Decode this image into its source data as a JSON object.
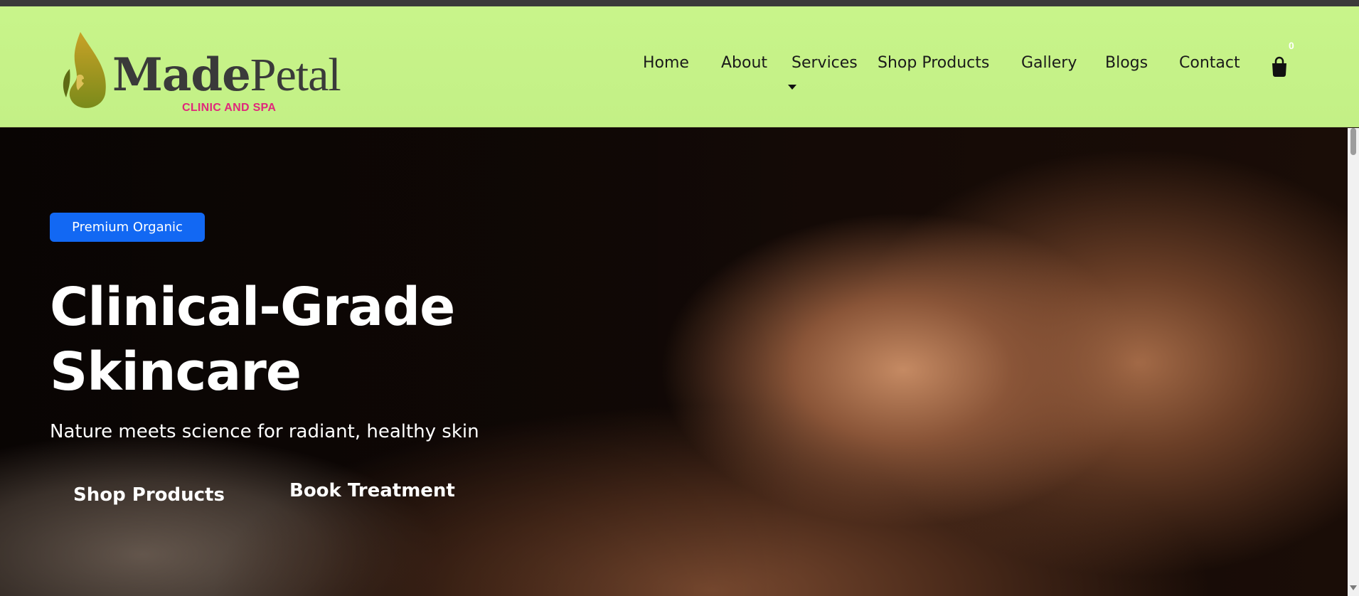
{
  "logo": {
    "name_part1": "Made",
    "name_part2": "Petal",
    "tagline": "CLINIC AND SPA"
  },
  "nav": {
    "items": [
      {
        "label": "Home"
      },
      {
        "label": "About"
      },
      {
        "label": "Services"
      },
      {
        "label": "Shop Products"
      },
      {
        "label": "Gallery"
      },
      {
        "label": "Blogs"
      },
      {
        "label": "Contact"
      }
    ],
    "cart_count": "0",
    "cart_icon": "shopping-bag-icon"
  },
  "hero": {
    "badge": "Premium Organic",
    "title_line1": "Clinical-Grade",
    "title_line2": "Skincare",
    "subtitle": "Nature meets science for radiant, healthy skin",
    "primary_button": "Shop Products",
    "secondary_button": "Book Treatment"
  },
  "colors": {
    "header_bg": "#c8f48a",
    "badge_bg": "#1268f3",
    "tagline": "#e0287b",
    "logo_text": "#3a3a3a"
  }
}
